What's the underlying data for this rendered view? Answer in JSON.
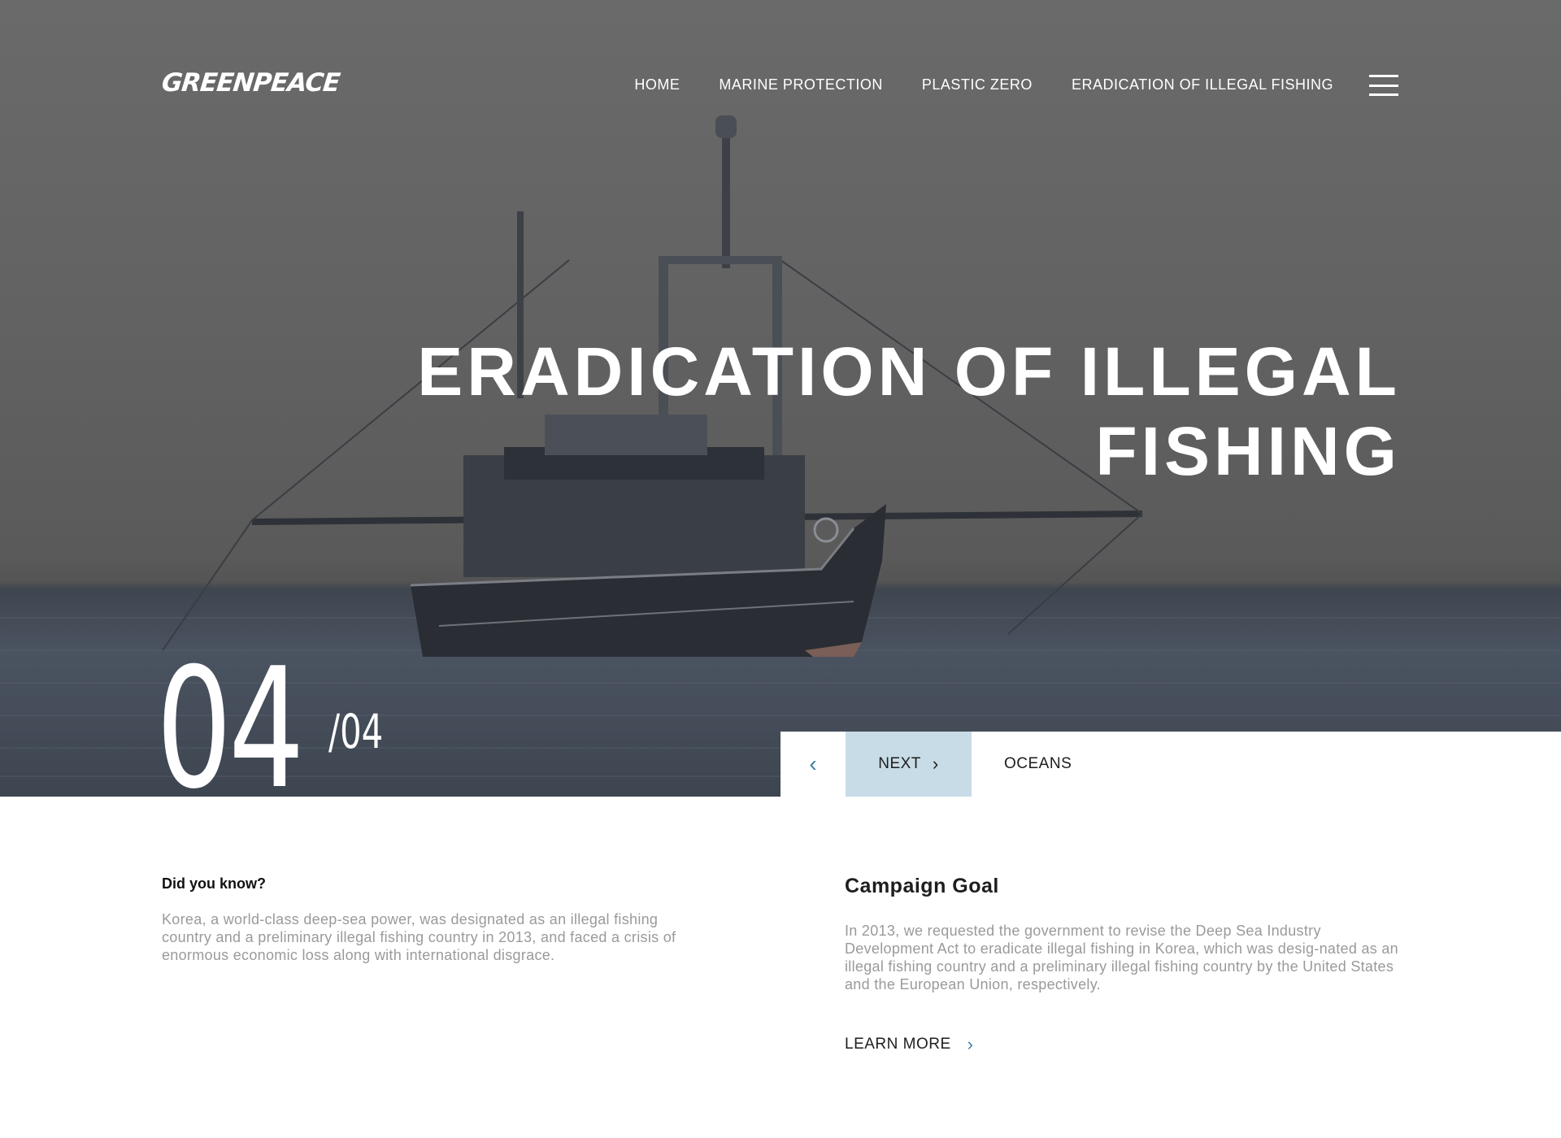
{
  "header": {
    "logo": "GREENPEACE",
    "nav": [
      "HOME",
      "MARINE PROTECTION",
      "PLASTIC ZERO",
      "ERADICATION OF ILLEGAL FISHING"
    ]
  },
  "hero": {
    "title_line1": "ERADICATION OF ILLEGAL",
    "title_line2": "FISHING",
    "slide_current": "04",
    "slide_total": "/04"
  },
  "controls": {
    "prev_icon": "chevron-left-icon",
    "next_label": "NEXT",
    "next_icon": "chevron-right-icon",
    "next_slide_label": "OCEANS"
  },
  "did_you_know": {
    "title": "Did you know?",
    "body": "Korea, a world-class deep-sea power, was designated as an illegal fishing country and a preliminary illegal fishing country in 2013, and faced a crisis of enormous economic loss along with international disgrace."
  },
  "campaign_goal": {
    "title": "Campaign Goal",
    "body": "In 2013, we requested the government to revise the Deep Sea Industry Development Act to eradicate illegal fishing in Korea, which was desig-nated as an illegal fishing country and a preliminary illegal fishing country by the United States and the European Union, respectively.",
    "link": "LEARN MORE"
  },
  "colors": {
    "accent": "#3a7fa8",
    "next_button_bg": "#c8dce7"
  }
}
